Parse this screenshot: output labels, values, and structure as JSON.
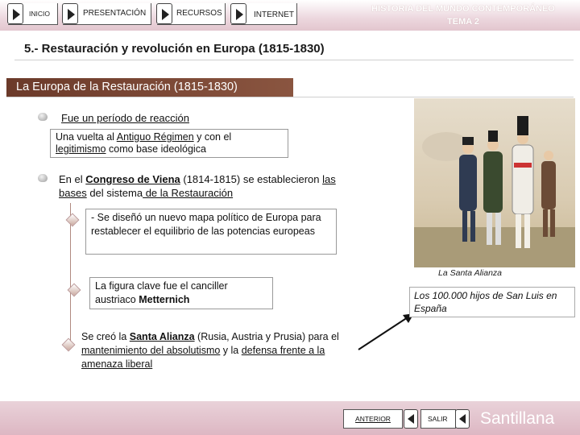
{
  "nav": {
    "inicio": "INICIO",
    "presentacion": "PRESENTACIÓN",
    "recursos": "RECURSOS",
    "internet": "INTERNET"
  },
  "header": {
    "title_line1": "HISTORIA DEL MUNDO CONTEMPORÁNEO",
    "title_line2": "TEMA 2"
  },
  "section_title": "5.- Restauración y revolución en Europa (1815-1830)",
  "subtitle": "La Europa de la Restauración (1815-1830)",
  "point1": {
    "text": "Fue un período de reacción",
    "box_a": "Una vuelta al ",
    "box_b": "Antiguo Régimen",
    "box_c": " y con el ",
    "box_d": "legitimismo",
    "box_e": " como base ideológica"
  },
  "point2": {
    "a": "En el ",
    "b": "Congreso de Viena",
    "c": " (1814-1815) se establecieron ",
    "d": "las bases",
    "e": " del sistema",
    "f": " de la Restauración"
  },
  "sub1": "- Se diseñó un nuevo mapa político de Europa para restablecer el equilibrio de las potencias europeas",
  "sub2": {
    "a": "La figura clave fue el canciller austriaco ",
    "b": "Metternich"
  },
  "sub3": {
    "a": "Se creó la ",
    "b": "Santa Alianza",
    "c": " (Rusia, Austria y Prusia) para el ",
    "d": "mantenimiento del absolutismo",
    "e": " y la ",
    "f": "defensa frente a la amenaza liberal"
  },
  "image_caption": "La Santa Alianza",
  "caption_box": "Los 100.000 hijos de San Luis en España",
  "footer": {
    "anterior": "ANTERIOR",
    "salir": "SALIR",
    "brand": "Santillana"
  },
  "colors": {
    "ribbon": "#7a4535",
    "topbar": "#e3c6cf",
    "bottombar": "#ddb7c3"
  }
}
